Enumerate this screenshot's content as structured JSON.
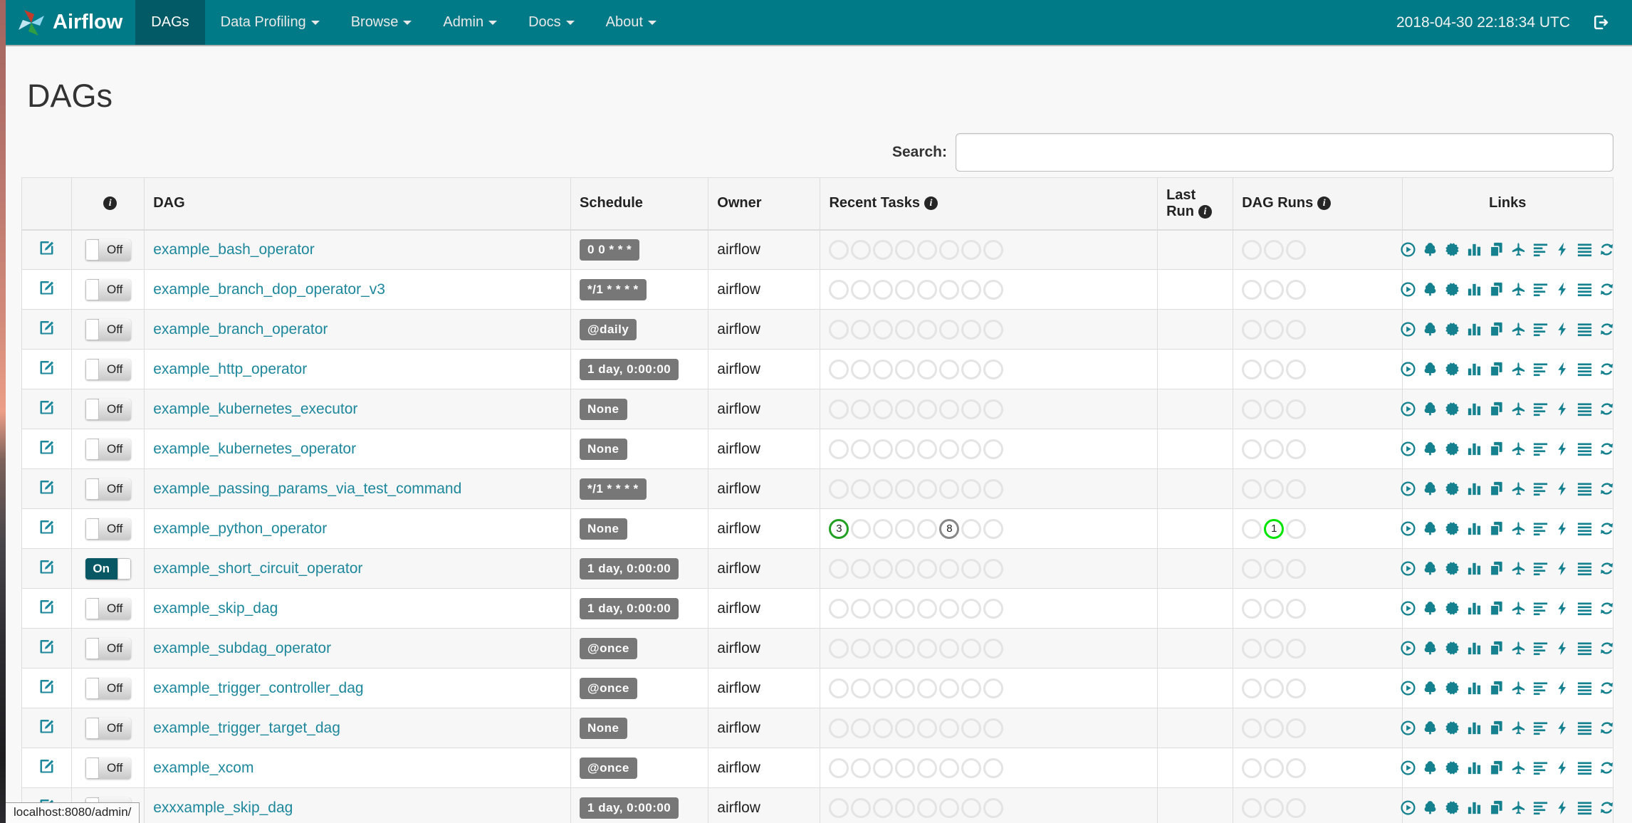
{
  "navbar": {
    "brand": "Airflow",
    "items": [
      {
        "label": "DAGs",
        "active": true,
        "caret": false
      },
      {
        "label": "Data Profiling",
        "active": false,
        "caret": true
      },
      {
        "label": "Browse",
        "active": false,
        "caret": true
      },
      {
        "label": "Admin",
        "active": false,
        "caret": true
      },
      {
        "label": "Docs",
        "active": false,
        "caret": true
      },
      {
        "label": "About",
        "active": false,
        "caret": true
      }
    ],
    "clock": "2018-04-30 22:18:34 UTC"
  },
  "page": {
    "title": "DAGs"
  },
  "search": {
    "label": "Search:",
    "value": ""
  },
  "statusbar": {
    "text": "localhost:8080/admin/"
  },
  "colors": {
    "navbar": "#007a87",
    "nav_active": "#015a66",
    "link": "#1d879c",
    "badge": "#777777",
    "state_success": "#23a023",
    "state_none": "#888888",
    "state_running": "#00e400"
  },
  "table": {
    "headers": {
      "dag": "DAG",
      "schedule": "Schedule",
      "owner": "Owner",
      "recent_tasks": "Recent Tasks",
      "last_run": "Last Run",
      "dag_runs": "DAG Runs",
      "links": "Links"
    },
    "recent_task_slots": 8,
    "dag_run_slots": 3,
    "link_icons": [
      "trigger-dag",
      "tree-view",
      "graph-view",
      "task-duration",
      "task-tries",
      "landing-times",
      "gantt-view",
      "code-view",
      "logs",
      "refresh"
    ],
    "rows": [
      {
        "name": "example_bash_operator",
        "toggle": "Off",
        "schedule": "0 0 * * *",
        "owner": "airflow",
        "last_run": "",
        "recent_tasks": [],
        "dag_runs": []
      },
      {
        "name": "example_branch_dop_operator_v3",
        "toggle": "Off",
        "schedule": "*/1 * * * *",
        "owner": "airflow",
        "last_run": "",
        "recent_tasks": [],
        "dag_runs": []
      },
      {
        "name": "example_branch_operator",
        "toggle": "Off",
        "schedule": "@daily",
        "owner": "airflow",
        "last_run": "",
        "recent_tasks": [],
        "dag_runs": []
      },
      {
        "name": "example_http_operator",
        "toggle": "Off",
        "schedule": "1 day, 0:00:00",
        "owner": "airflow",
        "last_run": "",
        "recent_tasks": [],
        "dag_runs": []
      },
      {
        "name": "example_kubernetes_executor",
        "toggle": "Off",
        "schedule": "None",
        "owner": "airflow",
        "last_run": "",
        "recent_tasks": [],
        "dag_runs": []
      },
      {
        "name": "example_kubernetes_operator",
        "toggle": "Off",
        "schedule": "None",
        "owner": "airflow",
        "last_run": "",
        "recent_tasks": [],
        "dag_runs": []
      },
      {
        "name": "example_passing_params_via_test_command",
        "toggle": "Off",
        "schedule": "*/1 * * * *",
        "owner": "airflow",
        "last_run": "",
        "recent_tasks": [],
        "dag_runs": []
      },
      {
        "name": "example_python_operator",
        "toggle": "Off",
        "schedule": "None",
        "owner": "airflow",
        "last_run": "",
        "recent_tasks": [
          {
            "slot": 0,
            "count": "3",
            "state": "success",
            "color": "#23a023"
          },
          {
            "slot": 5,
            "count": "8",
            "state": "none",
            "color": "#888888"
          }
        ],
        "dag_runs": [
          {
            "slot": 1,
            "count": "1",
            "state": "running",
            "color": "#00e400"
          }
        ]
      },
      {
        "name": "example_short_circuit_operator",
        "toggle": "On",
        "schedule": "1 day, 0:00:00",
        "owner": "airflow",
        "last_run": "",
        "recent_tasks": [],
        "dag_runs": []
      },
      {
        "name": "example_skip_dag",
        "toggle": "Off",
        "schedule": "1 day, 0:00:00",
        "owner": "airflow",
        "last_run": "",
        "recent_tasks": [],
        "dag_runs": []
      },
      {
        "name": "example_subdag_operator",
        "toggle": "Off",
        "schedule": "@once",
        "owner": "airflow",
        "last_run": "",
        "recent_tasks": [],
        "dag_runs": []
      },
      {
        "name": "example_trigger_controller_dag",
        "toggle": "Off",
        "schedule": "@once",
        "owner": "airflow",
        "last_run": "",
        "recent_tasks": [],
        "dag_runs": []
      },
      {
        "name": "example_trigger_target_dag",
        "toggle": "Off",
        "schedule": "None",
        "owner": "airflow",
        "last_run": "",
        "recent_tasks": [],
        "dag_runs": []
      },
      {
        "name": "example_xcom",
        "toggle": "Off",
        "schedule": "@once",
        "owner": "airflow",
        "last_run": "",
        "recent_tasks": [],
        "dag_runs": []
      },
      {
        "name": "exxxample_skip_dag",
        "toggle": "Off",
        "schedule": "1 day, 0:00:00",
        "owner": "airflow",
        "last_run": "",
        "recent_tasks": [],
        "dag_runs": []
      }
    ]
  }
}
